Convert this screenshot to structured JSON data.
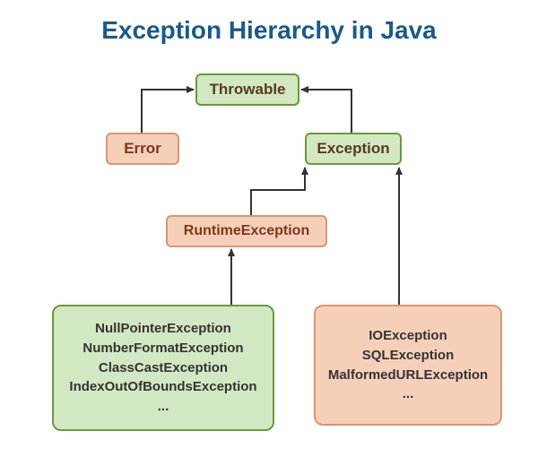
{
  "title": "Exception Hierarchy in Java",
  "nodes": {
    "throwable": "Throwable",
    "error": "Error",
    "exception": "Exception",
    "runtime": "RuntimeException"
  },
  "runtime_children": [
    "NullPointerException",
    "NumberFormatException",
    "ClassCastException",
    "IndexOutOfBoundsException",
    "..."
  ],
  "checked_children": [
    "IOException",
    "SQLException",
    "MalformedURLException",
    "..."
  ]
}
